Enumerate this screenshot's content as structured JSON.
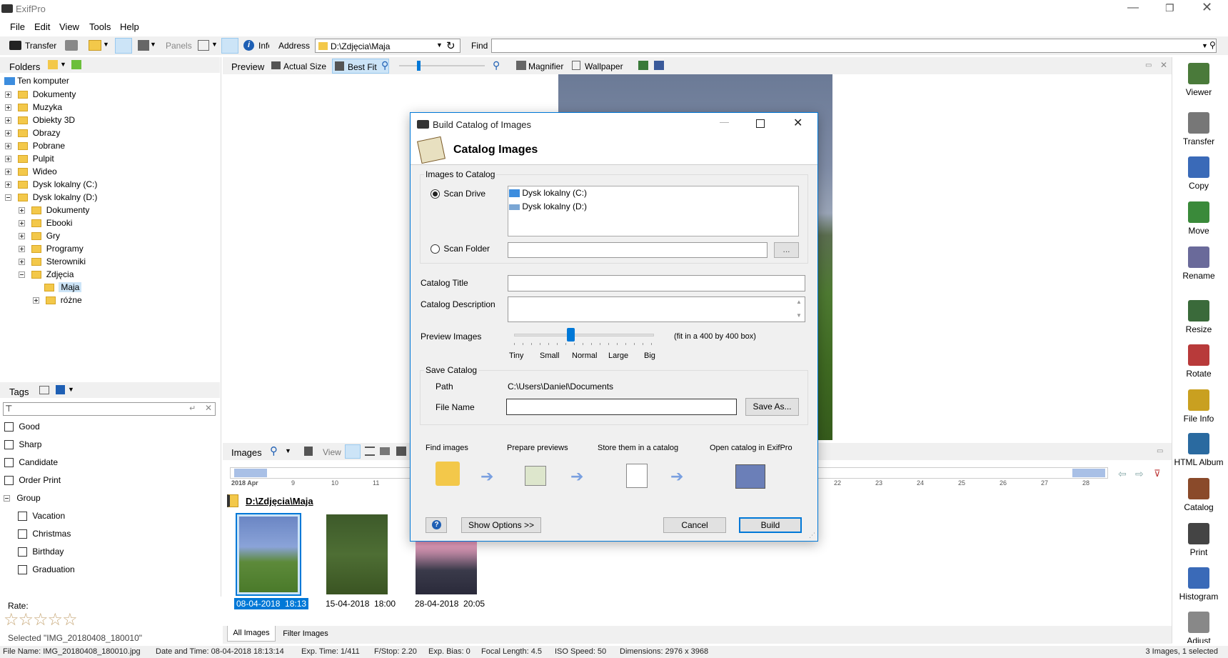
{
  "window": {
    "title": "ExifPro"
  },
  "menu": [
    "File",
    "Edit",
    "View",
    "Tools",
    "Help"
  ],
  "toolbar": {
    "transfer": "Transfer",
    "panels": "Panels",
    "info": "Info",
    "address_label": "Address",
    "address_value": "D:\\Zdjęcia\\Maja",
    "find_label": "Find"
  },
  "folders": {
    "title": "Folders",
    "root": "Ten komputer",
    "items": [
      "Dokumenty",
      "Muzyka",
      "Obiekty 3D",
      "Obrazy",
      "Pobrane",
      "Pulpit",
      "Wideo",
      "Dysk lokalny (C:)",
      "Dysk lokalny (D:)"
    ],
    "d_children": [
      "Dokumenty",
      "Ebooki",
      "Gry",
      "Programy",
      "Sterowniki",
      "Zdjęcia"
    ],
    "zdj_children": [
      "Maja",
      "różne"
    ]
  },
  "tags": {
    "title": "Tags",
    "items": [
      "Good",
      "Sharp",
      "Candidate",
      "Order Print"
    ],
    "group": "Group",
    "group_items": [
      "Vacation",
      "Christmas",
      "Birthday",
      "Graduation"
    ]
  },
  "rate": {
    "label": "Rate:",
    "stars": 0,
    "selected": "Selected \"IMG_20180408_180010\""
  },
  "preview": {
    "title": "Preview",
    "actual": "Actual Size",
    "bestfit": "Best Fit",
    "magnifier": "Magnifier",
    "wallpaper": "Wallpaper"
  },
  "images": {
    "title": "Images",
    "view": "View",
    "path": "D:\\Zdjęcia\\Maja",
    "timeline": {
      "month": "2018 Apr",
      "days": [
        "9",
        "10",
        "11",
        "22",
        "23",
        "24",
        "25",
        "26",
        "27",
        "28"
      ]
    },
    "thumbs": [
      {
        "label": "08-04-2018  18:13"
      },
      {
        "label": "15-04-2018  18:00"
      },
      {
        "label": "28-04-2018  20:05"
      }
    ],
    "tabs": [
      "All Images",
      "Filter Images"
    ]
  },
  "sidebar": [
    "Viewer",
    "Transfer",
    "Copy",
    "Move",
    "Rename",
    "Resize",
    "Rotate",
    "File Info",
    "HTML Album",
    "Catalog",
    "Print",
    "Histogram",
    "Adjust"
  ],
  "status": {
    "file": "File Name: IMG_20180408_180010.jpg",
    "date": "Date and Time: 08-04-2018  18:13:14",
    "exp": "Exp. Time: 1/411",
    "fstop": "F/Stop: 2.20",
    "bias": "Exp. Bias: 0",
    "focal": "Focal Length: 4.5",
    "iso": "ISO Speed: 50",
    "dim": "Dimensions: 2976 x 3968",
    "count": "3 Images, 1 selected"
  },
  "dialog": {
    "title": "Build Catalog of Images",
    "heading": "Catalog Images",
    "images_group": "Images to Catalog",
    "scan_drive": "Scan Drive",
    "drives": [
      "Dysk lokalny (C:)",
      "Dysk lokalny (D:)"
    ],
    "scan_folder": "Scan Folder",
    "browse": "...",
    "catalog_title": "Catalog Title",
    "catalog_desc": "Catalog Description",
    "preview_images": "Preview Images",
    "preview_hint": "(fit in a 400 by 400 box)",
    "sizes": [
      "Tiny",
      "Small",
      "Normal",
      "Large",
      "Big"
    ],
    "preview_level": 0.4,
    "save_group": "Save Catalog",
    "path_label": "Path",
    "path_value": "C:\\Users\\Daniel\\Documents",
    "file_name": "File Name",
    "save_as": "Save As...",
    "steps": [
      "Find images",
      "Prepare previews",
      "Store them in a catalog",
      "Open catalog in ExifPro"
    ],
    "help": "?",
    "show_options": "Show Options >>",
    "cancel": "Cancel",
    "build": "Build"
  },
  "colors": {
    "selection": "#cce4f7",
    "accent": "#0078d7",
    "folder": "#f3c84a"
  }
}
